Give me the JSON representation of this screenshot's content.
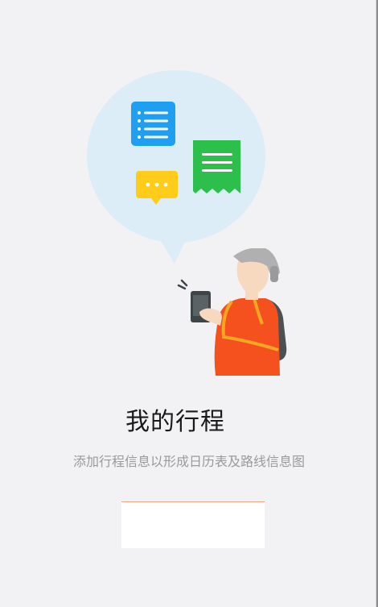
{
  "page": {
    "title": "我的行程",
    "subtitle": "添加行程信息以形成日历表及路线信息图"
  },
  "colors": {
    "background": "#f2f2f4",
    "bubble": "#dcedf8",
    "list_icon": "#1e9ff2",
    "chat_icon": "#ffcc1a",
    "receipt_icon": "#2dbf4b",
    "shirt": "#f4511e",
    "backpack": "#4a5155",
    "hat": "#b0b0b0",
    "skin": "#f7d9bf",
    "phone": "#3e4548",
    "strap": "#f5a623",
    "accent": "#ff5722"
  },
  "icons": [
    "list-icon",
    "chat-icon",
    "receipt-icon"
  ],
  "button": {
    "label": ""
  }
}
